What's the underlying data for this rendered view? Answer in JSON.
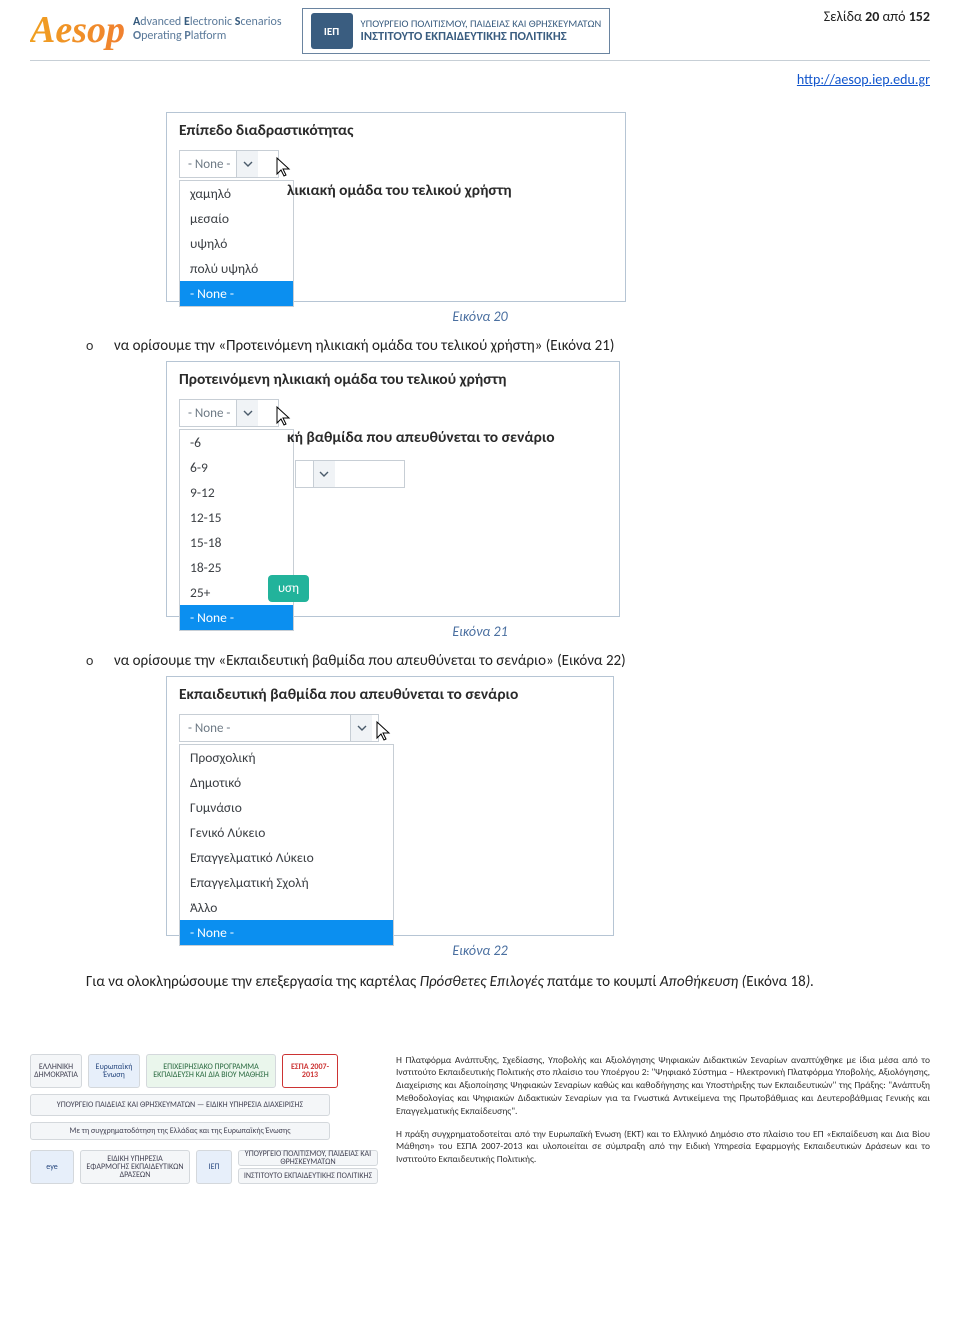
{
  "header": {
    "aesop_acronym": "Aesop",
    "aesop_line1_html": "Advanced Electronic Scenarios",
    "aesop_line2_html": "Operating Platform",
    "iep_mark": "ΙΕΠ",
    "iep_small": "ΥΠΟΥΡΓΕΙΟ ΠΟΛΙΤΙΣΜΟΥ, ΠΑΙΔΕΙΑΣ ΚΑΙ ΘΡΗΣΚΕΥΜΑΤΩΝ",
    "iep_big": "ΙΝΣΤΙΤΟΥΤΟ ΕΚΠΑΙΔΕΥΤΙΚΗΣ ΠΟΛΙΤΙΚΗΣ",
    "page_label_prefix": "Σελίδα ",
    "page_current": "20",
    "page_label_mid": " από ",
    "page_total": "152",
    "link": "http://aesop.iep.edu.gr"
  },
  "fig20": {
    "title": "Επίπεδο διαδραστικότητας",
    "selected": "- None -",
    "options": [
      "χαμηλό",
      "μεσαίο",
      "υψηλό",
      "πολύ υψηλό",
      "- None -"
    ],
    "overlay_text": "λικιακή ομάδα του τελικού χρήστη",
    "caption": "Εικόνα 20"
  },
  "bullet1": {
    "marker": "o",
    "text": "να ορίσουμε την «Προτεινόμενη ηλικιακή ομάδα του τελικού χρήστη» (Εικόνα 21)"
  },
  "fig21": {
    "title": "Προτεινόμενη ηλικιακή ομάδα του τελικού χρήστη",
    "selected": "- None -",
    "options": [
      "-6",
      "6-9",
      "9-12",
      "12-15",
      "15-18",
      "18-25",
      "25+",
      "- None -"
    ],
    "overlay_text": "κή βαθμίδα που απευθύνεται το σενάριο",
    "teal_button": "υση",
    "caption": "Εικόνα 21"
  },
  "bullet2": {
    "marker": "o",
    "text": "να ορίσουμε την «Εκπαιδευτική βαθμίδα που απευθύνεται το σενάριο» (Εικόνα 22)"
  },
  "fig22": {
    "title": "Εκπαιδευτική βαθμίδα που απευθύνεται το σενάριο",
    "selected": "- None -",
    "options": [
      "Προσχολική",
      "Δημοτικό",
      "Γυμνάσιο",
      "Γενικό Λύκειο",
      "Επαγγελματικό Λύκειο",
      "Επαγγελματική Σχολή",
      "Άλλο",
      "- None -"
    ],
    "caption": "Εικόνα 22"
  },
  "para1_a": "Για να ολοκληρώσουμε την επεξεργασία της καρτέλας ",
  "para1_i": "Πρόσθετες Επιλογές",
  "para1_b": " πατάμε το κουμπί ",
  "para1_i2": "Αποθήκευση (",
  "para1_c": "Εικόνα 18",
  "para1_i3": ").",
  "footer": {
    "logos": {
      "gr": "ΕΛΛΗΝΙΚΗ ΔΗΜΟΚΡΑΤΙΑ",
      "eu": "Ευρωπαϊκή Ένωση",
      "epeaek": "ΕΠΙΧΕΙΡΗΣΙΑΚΟ ΠΡΟΓΡΑΜΜΑ ΕΚΠΑΙΔΕΥΣΗ ΚΑΙ ΔΙΑ ΒΙΟΥ ΜΑΘΗΣΗ",
      "ypepth": "ΥΠΟΥΡΓΕΙΟ ΠΑΙΔΕΙΑΣ ΚΑΙ ΘΡΗΣΚΕΥΜΑΤΩΝ — ΕΙΔΙΚΗ ΥΠΗΡΕΣΙΑ ΔΙΑΧΕΙΡΙΣΗΣ",
      "cofin": "Με τη συγχρηματοδότηση της Ελλάδας και της Ευρωπαϊκής Ένωσης",
      "espa": "ΕΣΠΑ 2007-2013",
      "eye": "eye",
      "eye_sub": "ΕΙΔΙΚΗ ΥΠΗΡΕΣΙΑ ΕΦΑΡΜΟΓΗΣ ΕΚΠΑΙΔΕΥΤΙΚΩΝ ΔΡΑΣΕΩΝ",
      "iep": "ΙΕΠ",
      "iep2a": "ΥΠΟΥΡΓΕΙΟ ΠΟΛΙΤΙΣΜΟΥ, ΠΑΙΔΕΙΑΣ ΚΑΙ ΘΡΗΣΚΕΥΜΑΤΩΝ",
      "iep2b": "ΙΝΣΤΙΤΟΥΤΟ ΕΚΠΑΙΔΕΥΤΙΚΗΣ ΠΟΛΙΤΙΚΗΣ"
    },
    "p1": "Η Πλατφόρμα Ανάπτυξης, Σχεδίασης, Υποβολής και Αξιολόγησης Ψηφιακών Διδακτικών Σεναρίων αναπτύχθηκε με ίδια μέσα από το Ινστιτούτο Εκπαιδευτικής Πολιτικής στο πλαίσιο του Υποέργου 2: \"Ψηφιακό Σύστημα – Ηλεκτρονική Πλατφόρμα Υποβολής, Αξιολόγησης, Διαχείρισης και Αξιοποίησης Ψηφιακών Σεναρίων καθώς και καθοδήγησης και Υποστήριξης των Εκπαιδευτικών\" της Πράξης: \"Ανάπτυξη Μεθοδολογίας και Ψηφιακών Διδακτικών Σεναρίων για τα Γνωστικά Αντικείμενα της Πρωτοβάθμιας και Δευτεροβάθμιας Γενικής και Επαγγελματικής Εκπαίδευσης\".",
    "p2": "Η πράξη συγχρηματοδοτείται από την Ευρωπαϊκή Ένωση (ΕΚΤ) και το Ελληνικό Δημόσιο στο πλαίσιο του ΕΠ «Εκπαίδευση και Δια Βίου Μάθηση» του ΕΣΠΑ 2007-2013 και υλοποιείται σε σύμπραξη από την Ειδική Υπηρεσία Εφαρμογής Εκπαιδευτικών Δράσεων και το Ινστιτούτο Εκπαιδευτικής Πολιτικής."
  }
}
